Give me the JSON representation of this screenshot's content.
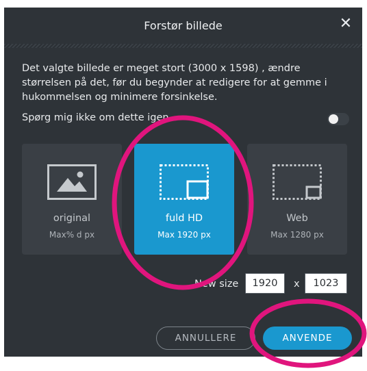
{
  "dialog": {
    "title": "Forstør billede",
    "close_icon": "close-icon",
    "message": "Det valgte billede er meget stort (3000 x 1598) , ændre størrelsen på det, før du begynder at redigere for at gemme i hukommelsen og minimere forsinkelse.",
    "ask_label": "Spørg mig ikke om dette igen",
    "ask_toggle_on": false
  },
  "options": [
    {
      "label": "original",
      "sub": "Max% d px",
      "icon": "image-icon",
      "selected": false
    },
    {
      "label": "fuld HD",
      "sub": "Max 1920 px",
      "icon": "resize-large-icon",
      "selected": true
    },
    {
      "label": "Web",
      "sub": "Max 1280 px",
      "icon": "resize-small-icon",
      "selected": false
    }
  ],
  "new_size": {
    "label": "New size",
    "width": "1920",
    "separator": "x",
    "height": "1023"
  },
  "buttons": {
    "cancel": "ANNULLERE",
    "apply": "ANVENDE"
  },
  "colors": {
    "dialog_bg": "#2e3338",
    "accent": "#1a98cf",
    "annotation": "#e0157d"
  }
}
